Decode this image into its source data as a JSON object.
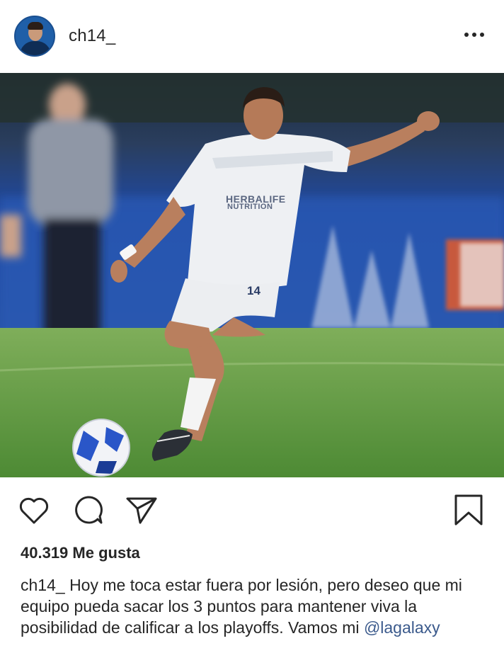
{
  "post": {
    "username": "ch14_",
    "likes": "40.319 Me gusta",
    "caption": {
      "username": "ch14_",
      "text": "Hoy me toca estar fuera por lesión, pero deseo que mi equipo pueda sacar los 3 puntos para mantener viva la posibilidad de calificar a los playoffs. Vamos mi",
      "mention": "@lagalaxy"
    },
    "jersey": {
      "sponsor_line1": "HERBALIFE",
      "sponsor_line2": "NUTRITION",
      "number": "14"
    }
  },
  "icons": {
    "more": "more-options-icon",
    "like": "heart-icon",
    "comment": "comment-bubble-icon",
    "share": "paper-plane-icon",
    "save": "bookmark-icon"
  },
  "colors": {
    "text": "#262626",
    "mention": "#3b5a8c",
    "pitch": "#4f8a3a",
    "stadium_blue": "#2b4b8a"
  }
}
